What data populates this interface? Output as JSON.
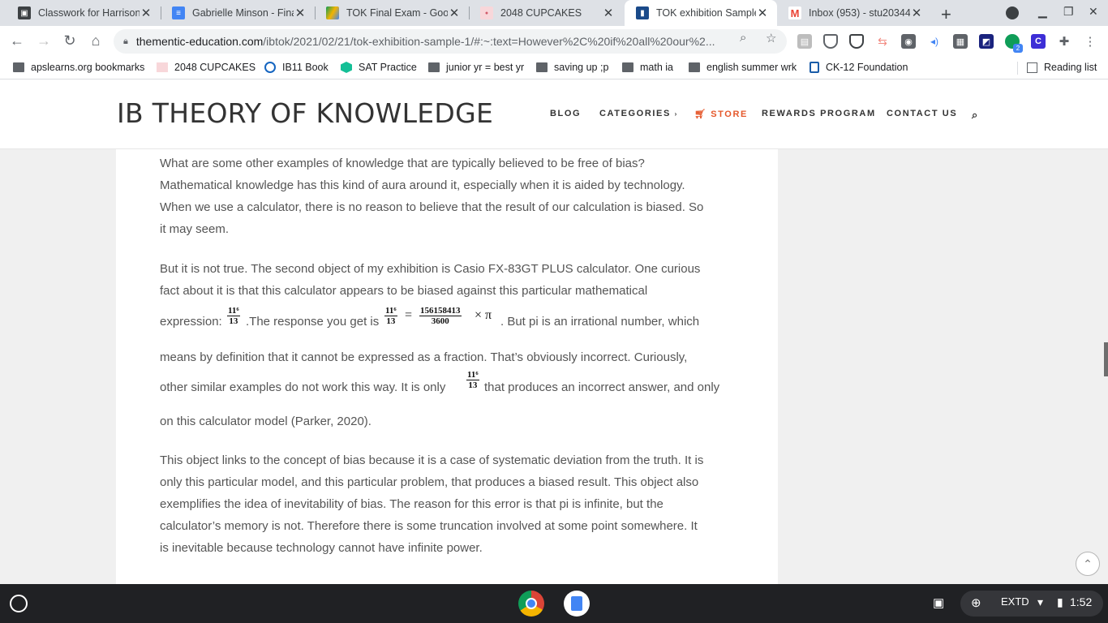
{
  "browser": {
    "tabs": [
      {
        "title": "Classwork for Harrison",
        "icon": "classroom-icon",
        "color": "#3c4043"
      },
      {
        "title": "Gabrielle Minson - Fina",
        "icon": "docs-icon",
        "color": "#4285f4"
      },
      {
        "title": "TOK Final Exam - Goog",
        "icon": "drive-icon",
        "color": "#f4b400"
      },
      {
        "title": "2048 CUPCAKES",
        "icon": "cupcake-icon",
        "color": "#f28b82"
      },
      {
        "title": "TOK exhibition Sample",
        "icon": "book-icon",
        "color": "#1a4a8a",
        "active": true
      },
      {
        "title": "Inbox (953) - stu20344",
        "icon": "gmail-icon",
        "color": "#ea4335"
      }
    ],
    "url_host": "thementic-education.com",
    "url_path": "/ibtok/2021/02/21/tok-exhibition-sample-1/#:~:text=However%2C%20if%20all%20our%2...",
    "bookmarks": [
      {
        "label": "apslearns.org bookmarks",
        "icon": "folder-icon"
      },
      {
        "label": "2048 CUPCAKES",
        "icon": "cupcake-icon"
      },
      {
        "label": "IB11 Book",
        "icon": "edge-icon"
      },
      {
        "label": "SAT Practice",
        "icon": "khan-icon"
      },
      {
        "label": "junior yr = best yr",
        "icon": "folder-icon"
      },
      {
        "label": "saving up ;p",
        "icon": "folder-icon"
      },
      {
        "label": "math ia",
        "icon": "folder-icon"
      },
      {
        "label": "english summer wrk",
        "icon": "folder-icon"
      },
      {
        "label": "CK-12 Foundation",
        "icon": "ck12-icon"
      }
    ],
    "reading_list": "Reading list"
  },
  "site": {
    "title": "IB THEORY OF KNOWLEDGE",
    "nav": [
      "BLOG",
      "CATEGORIES",
      "STORE",
      "REWARDS PROGRAM",
      "CONTACT US"
    ],
    "accent": "#e5582b"
  },
  "article": {
    "p1": [
      "What are some other examples of knowledge that are typically believed to be free of bias?",
      "Mathematical knowledge has this kind of aura around it, especially when it is aided by technology.",
      "When we use a calculator, there is no reason to believe that the result of our calculation is biased. So",
      "it may seem."
    ],
    "p2_lines": [
      "But it is not true. The second object of my exhibition is Casio FX-83GT PLUS calculator. One curious",
      "fact about it is that this calculator appears to be biased against this particular mathematical"
    ],
    "p2_expr_lead": "expression:",
    "p2_expr_mid": ".The response you get is",
    "p2_expr_tail": ". But pi is an irrational number, which",
    "p2_line4": "means by definition that it cannot be expressed as a fraction. That’s obviously incorrect. Curiously,",
    "p2_line5_a": "other similar examples do not work this way. It is only",
    "p2_line5_b": "that produces an incorrect answer, and only",
    "p2_line6": "on this calculator model (Parker, 2020).",
    "frac_num": "11⁶",
    "frac_den": "13",
    "result_num": "156158413",
    "result_den": "3600",
    "equals": "=",
    "times_pi": "× π",
    "p3": [
      "This object links to the concept of bias because it is a case of systematic deviation from the truth. It is",
      "only this particular model, and this particular problem, that produces a biased result. This object also",
      "exemplifies the idea of inevitability of bias. The reason for this error is that pi is infinite, but the",
      "calculator’s memory is not. Therefore there is some truncation involved at some point somewhere. It",
      "is inevitable because technology cannot have infinite power."
    ]
  },
  "shelf": {
    "ime": "EXTD",
    "time": "1:52",
    "extension_badge": "2"
  }
}
